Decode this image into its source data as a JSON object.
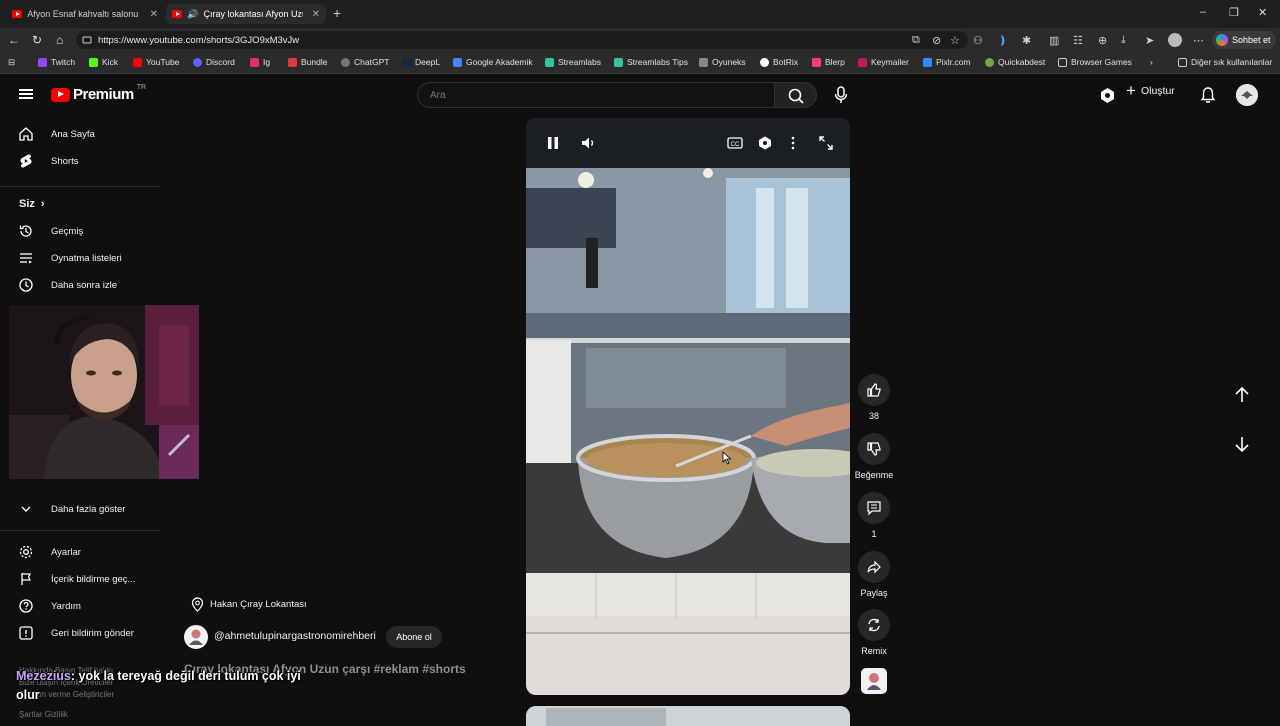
{
  "browser": {
    "tabs": [
      {
        "title": "Afyon Esnaf kahvaltı salonu Coğraf",
        "active": false
      },
      {
        "title": "Çıray lokantası Afyon Uzun ça",
        "active": true
      }
    ],
    "url": "https://www.youtube.com/shorts/3GJO9xM3vJw",
    "copilot_label": "Sohbet et",
    "bookmarks": [
      "Twitch",
      "Kick",
      "YouTube",
      "Discord",
      "Ig",
      "Bundle",
      "ChatGPT",
      "DeepL",
      "Google Akademik",
      "Streamlabs",
      "Streamlabs Tips",
      "Oyuneks",
      "BotRix",
      "Blerp",
      "Keymailer",
      "Pixlr.com",
      "Quickabdest",
      "Browser Games"
    ],
    "bookmarks_other": "Diğer sık kullanılanlar"
  },
  "youtube": {
    "logo_text": "Premium",
    "logo_region": "TR",
    "search_placeholder": "Ara",
    "create_label": "Oluştur",
    "sidebar": {
      "items_top": [
        "Ana Sayfa",
        "Shorts"
      ],
      "you_header": "Siz",
      "items_you": [
        "Geçmiş",
        "Oynatma listeleri",
        "Daha sonra izle"
      ],
      "show_more": "Daha fazla göster",
      "items_bottom": [
        "Ayarlar",
        "İçerik bildirme geç...",
        "Yardım",
        "Geri bildirim gönder"
      ],
      "footer_lines": [
        "Hakkında  Basın  Telif hakkı",
        "Bize ulaşın  İçerik Üreticiler",
        "Reklam verme  Geliştiriciler",
        "Şartlar  Gizlilik"
      ]
    },
    "short": {
      "location": "Hakan Çıray Lokantası",
      "channel": "@ahmetulupinargastronomirehberi",
      "subscribe_label": "Abone ol",
      "title": "Çıray lokantası Afyon Uzun çarşı #reklam #shorts",
      "likes": "38",
      "dislike_label": "Beğenme",
      "comments": "1",
      "share_label": "Paylaş",
      "remix_label": "Remix"
    }
  },
  "stream_chat": {
    "user": "Mezezius",
    "message": ": yok la tereyağ değil deri tulum çok iyi olur"
  }
}
